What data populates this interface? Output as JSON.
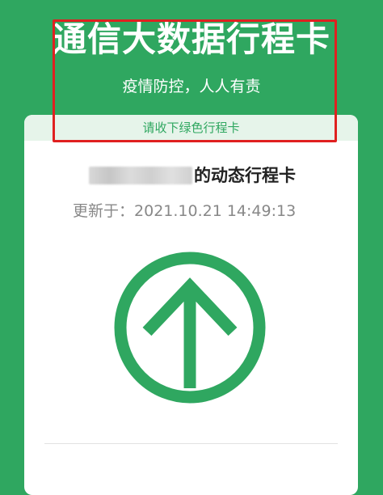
{
  "header": {
    "title": "通信大数据行程卡",
    "subtitle": "疫情防控，人人有责"
  },
  "card": {
    "ribbon_text": "请收下绿色行程卡",
    "owner_suffix": "的动态行程卡",
    "update_label": "更新于：",
    "update_time": "2021.10.21 14:49:13",
    "status_icon": "green-up-arrow-icon",
    "status_color": "#2fa760"
  },
  "colors": {
    "background": "#2fa760",
    "accent": "#2fa760",
    "highlight": "#e02020",
    "ribbon": "#e6f4ea"
  }
}
